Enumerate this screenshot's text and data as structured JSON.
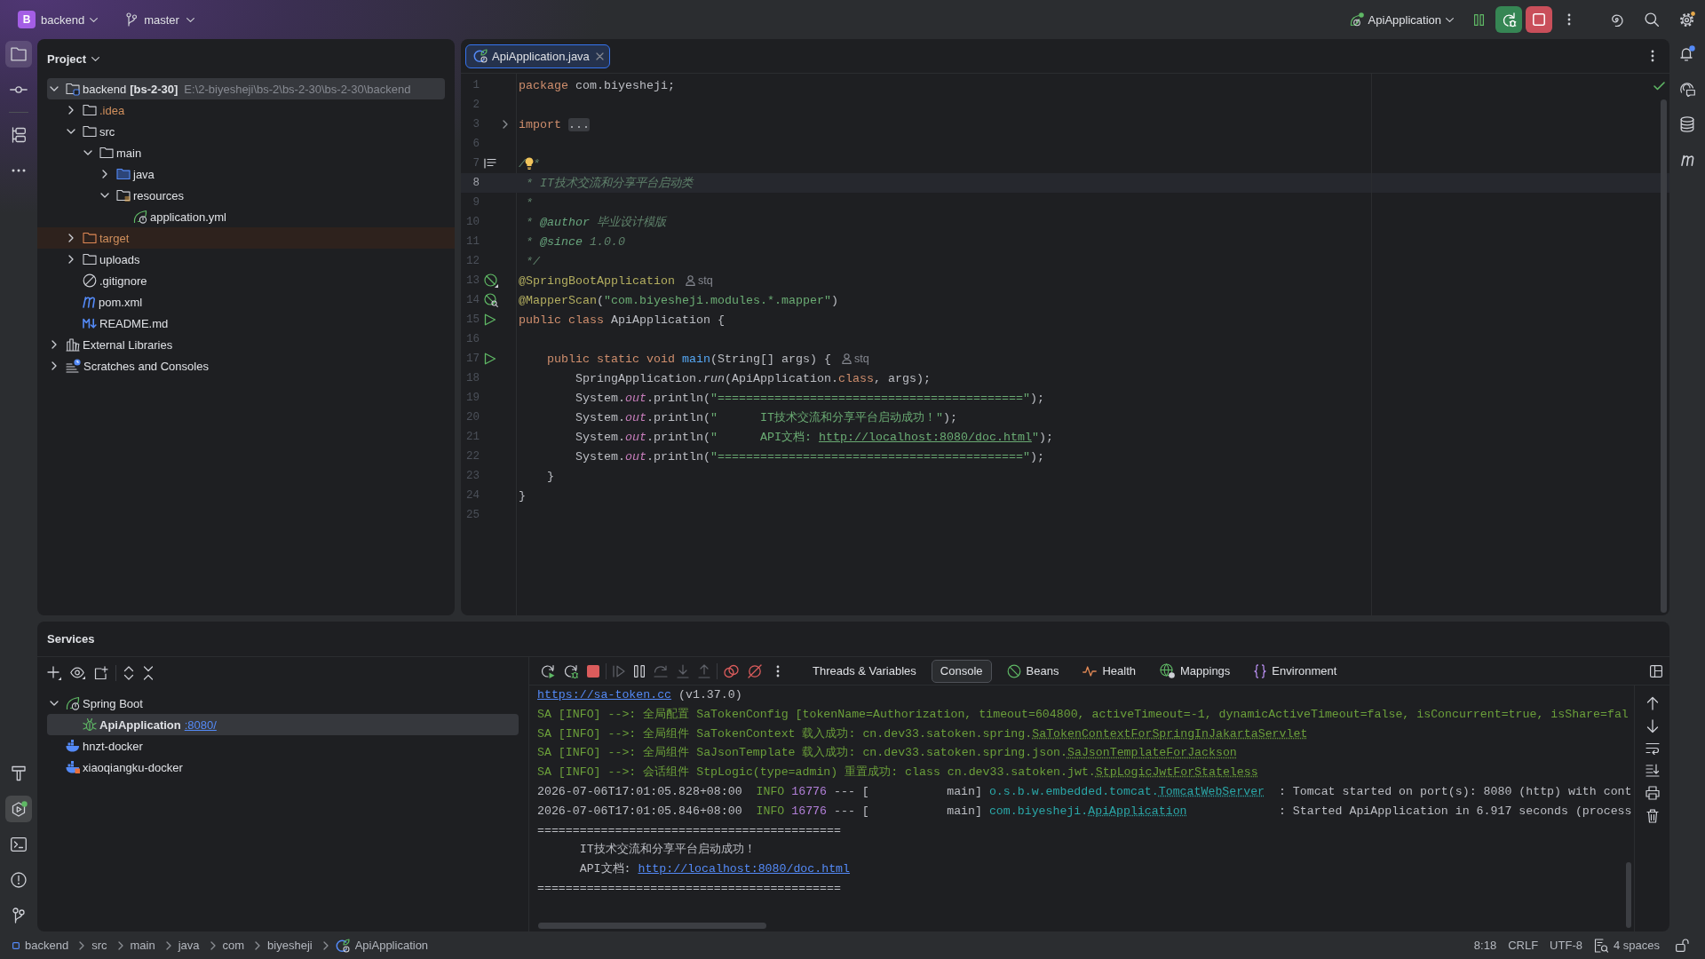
{
  "title_bar": {
    "project_badge": "B",
    "project": "backend",
    "branch": "master",
    "run_configuration": "ApiApplication"
  },
  "tool_strip_left": {
    "top": [
      {
        "selected": true
      },
      {
        "selected": false
      },
      {
        "selected": false
      },
      {
        "selected": false
      }
    ],
    "bottom": [
      {
        "selected": false
      },
      {
        "selected": true
      },
      {
        "selected": false
      },
      {
        "selected": false
      },
      {
        "selected": false
      }
    ]
  },
  "project_panel": {
    "title": "Project",
    "tree": [
      {
        "label": "backend",
        "module": "[bs-2-30]",
        "path": "E:\\2-biyesheji\\bs-2\\bs-2-30\\bs-2-30\\backend",
        "kind": "module",
        "expanded": true,
        "selected": true,
        "ignored": false,
        "excluded": false,
        "children": [
          {
            "label": ".idea",
            "kind": "folder",
            "expanded": false,
            "selected": false,
            "ignored": true,
            "excluded": false
          },
          {
            "label": "src",
            "kind": "folder",
            "expanded": true,
            "selected": false,
            "ignored": false,
            "excluded": false,
            "children": [
              {
                "label": "main",
                "kind": "folder",
                "expanded": true,
                "selected": false,
                "ignored": false,
                "excluded": false,
                "children": [
                  {
                    "label": "java",
                    "kind": "source-folder",
                    "expanded": false,
                    "selected": false,
                    "ignored": false,
                    "excluded": false
                  },
                  {
                    "label": "resources",
                    "kind": "resource-folder",
                    "expanded": true,
                    "selected": false,
                    "ignored": false,
                    "excluded": false,
                    "children": [
                      {
                        "label": "application.yml",
                        "kind": "spring-config",
                        "selected": false,
                        "ignored": false,
                        "excluded": false
                      }
                    ]
                  }
                ]
              }
            ]
          },
          {
            "label": "target",
            "kind": "folder",
            "expanded": false,
            "selected": false,
            "ignored": true,
            "excluded": true
          },
          {
            "label": "uploads",
            "kind": "folder",
            "expanded": false,
            "selected": false,
            "ignored": false,
            "excluded": false
          },
          {
            "label": ".gitignore",
            "kind": "ignore-file",
            "selected": false,
            "ignored": false,
            "excluded": false
          },
          {
            "label": "pom.xml",
            "kind": "maven",
            "selected": false,
            "ignored": false,
            "excluded": false
          },
          {
            "label": "README.md",
            "kind": "markdown",
            "selected": false,
            "ignored": false,
            "excluded": false
          }
        ]
      },
      {
        "label": "External Libraries",
        "kind": "libraries",
        "expanded": false,
        "selected": false,
        "ignored": false,
        "excluded": false
      },
      {
        "label": "Scratches and Consoles",
        "kind": "scratches",
        "expanded": false,
        "selected": false,
        "ignored": false,
        "excluded": false
      }
    ]
  },
  "editor": {
    "tabs": [
      {
        "label": "ApiApplication.java",
        "selected": true
      }
    ],
    "lines": [
      {
        "number": "1",
        "current": false,
        "tokens": [
          {
            "kind": "keyword",
            "text": "package"
          },
          {
            "kind": "plain",
            "text": " com.biyesheji;"
          }
        ]
      },
      {
        "number": "2",
        "current": false
      },
      {
        "number": "3",
        "current": false,
        "gutter": {
          "kind": "fold"
        },
        "tokens": [
          {
            "kind": "keyword",
            "text": "import "
          },
          {
            "kind": "folded",
            "text": "..."
          }
        ]
      },
      {
        "number": "6",
        "current": false
      },
      {
        "number": "7",
        "current": false,
        "gutter": {
          "kind": "doc"
        },
        "tokens": [
          {
            "kind": "doc",
            "text": "/"
          },
          {
            "kind": "bulb"
          },
          {
            "kind": "doc",
            "text": "*"
          }
        ]
      },
      {
        "number": "8",
        "current": true,
        "tokens": [
          {
            "kind": "doc",
            "text": " * IT技术交流和分享平台启动类"
          }
        ]
      },
      {
        "number": "9",
        "current": false,
        "tokens": [
          {
            "kind": "doc",
            "text": " *"
          }
        ]
      },
      {
        "number": "10",
        "current": false,
        "tokens": [
          {
            "kind": "doc",
            "text": " * "
          },
          {
            "kind": "doc-tag",
            "text": "@author"
          },
          {
            "kind": "doc",
            "text": " 毕业设计模版"
          }
        ]
      },
      {
        "number": "11",
        "current": false,
        "tokens": [
          {
            "kind": "doc",
            "text": " * "
          },
          {
            "kind": "doc-tag",
            "text": "@since"
          },
          {
            "kind": "doc",
            "text": " 1.0.0"
          }
        ]
      },
      {
        "number": "12",
        "current": false,
        "tokens": [
          {
            "kind": "doc",
            "text": " */"
          }
        ]
      },
      {
        "number": "13",
        "current": false,
        "gutter": {
          "kind": "bean"
        },
        "tokens": [
          {
            "kind": "annotation",
            "text": "@SpringBootApplication"
          },
          {
            "kind": "hint",
            "text": "stq"
          }
        ]
      },
      {
        "number": "14",
        "current": false,
        "gutter": {
          "kind": "mapper"
        },
        "tokens": [
          {
            "kind": "annotation",
            "text": "@MapperScan"
          },
          {
            "kind": "plain",
            "text": "("
          },
          {
            "kind": "string",
            "text": "\"com.biyesheji.modules.*.mapper\""
          },
          {
            "kind": "plain",
            "text": ")"
          }
        ]
      },
      {
        "number": "15",
        "current": false,
        "gutter": {
          "kind": "run"
        },
        "tokens": [
          {
            "kind": "keyword",
            "text": "public class"
          },
          {
            "kind": "plain",
            "text": " ApiApplication {"
          }
        ]
      },
      {
        "number": "16",
        "current": false
      },
      {
        "number": "17",
        "current": false,
        "gutter": {
          "kind": "run"
        },
        "tokens": [
          {
            "kind": "keyword",
            "text": "    public static void "
          },
          {
            "kind": "method",
            "text": "main"
          },
          {
            "kind": "plain",
            "text": "(String[] args) {"
          },
          {
            "kind": "hint",
            "text": "stq"
          }
        ]
      },
      {
        "number": "18",
        "current": false,
        "tokens": [
          {
            "kind": "plain",
            "text": "        SpringApplication."
          },
          {
            "kind": "static-call",
            "text": "run"
          },
          {
            "kind": "plain",
            "text": "(ApiApplication."
          },
          {
            "kind": "keyword",
            "text": "class"
          },
          {
            "kind": "plain",
            "text": ", args);"
          }
        ]
      },
      {
        "number": "19",
        "current": false,
        "tokens": [
          {
            "kind": "plain",
            "text": "        System."
          },
          {
            "kind": "static-field",
            "text": "out"
          },
          {
            "kind": "plain",
            "text": ".println("
          },
          {
            "kind": "string",
            "text": "\"===========================================\""
          },
          {
            "kind": "plain",
            "text": ");"
          }
        ]
      },
      {
        "number": "20",
        "current": false,
        "tokens": [
          {
            "kind": "plain",
            "text": "        System."
          },
          {
            "kind": "static-field",
            "text": "out"
          },
          {
            "kind": "plain",
            "text": ".println("
          },
          {
            "kind": "string",
            "text": "\"      IT技术交流和分享平台启动成功！\""
          },
          {
            "kind": "plain",
            "text": ");"
          }
        ]
      },
      {
        "number": "21",
        "current": false,
        "tokens": [
          {
            "kind": "plain",
            "text": "        System."
          },
          {
            "kind": "static-field",
            "text": "out"
          },
          {
            "kind": "plain",
            "text": ".println("
          },
          {
            "kind": "string",
            "text": "\"      API文档: "
          },
          {
            "kind": "string-link",
            "text": "http://localhost:8080/doc.html"
          },
          {
            "kind": "string",
            "text": "\""
          },
          {
            "kind": "plain",
            "text": ");"
          }
        ]
      },
      {
        "number": "22",
        "current": false,
        "tokens": [
          {
            "kind": "plain",
            "text": "        System."
          },
          {
            "kind": "static-field",
            "text": "out"
          },
          {
            "kind": "plain",
            "text": ".println("
          },
          {
            "kind": "string",
            "text": "\"===========================================\""
          },
          {
            "kind": "plain",
            "text": ");"
          }
        ]
      },
      {
        "number": "23",
        "current": false,
        "tokens": [
          {
            "kind": "plain",
            "text": "    }"
          }
        ]
      },
      {
        "number": "24",
        "current": false,
        "tokens": [
          {
            "kind": "plain",
            "text": "}"
          }
        ]
      },
      {
        "number": "25",
        "current": false
      }
    ]
  },
  "services_panel": {
    "title": "Services",
    "tree": [
      {
        "label": "Spring Boot",
        "kind": "spring-boot",
        "expanded": true,
        "selected": false,
        "children": [
          {
            "label": "ApiApplication",
            "link": ":8080/",
            "kind": "app",
            "selected": true
          }
        ]
      },
      {
        "label": "hnzt-docker",
        "kind": "docker",
        "selected": false
      },
      {
        "label": "xiaoqiangku-docker",
        "kind": "docker-flagged",
        "selected": false
      }
    ],
    "debug_toolbar": [
      {
        "disabled": false
      },
      {
        "disabled": false
      },
      {
        "disabled": false
      },
      {
        "disabled": true
      },
      {
        "disabled": false
      },
      {
        "disabled": true
      },
      {
        "disabled": true
      },
      {
        "disabled": true
      },
      {
        "disabled": false
      },
      {
        "disabled": false
      },
      {
        "disabled": false
      }
    ],
    "tabs": [
      {
        "label": "Threads & Variables",
        "kind": "plain",
        "selected": false
      },
      {
        "label": "Console",
        "kind": "plain",
        "selected": true
      },
      {
        "label": "Beans",
        "kind": "beans",
        "selected": false
      },
      {
        "label": "Health",
        "kind": "health",
        "selected": false
      },
      {
        "label": "Mappings",
        "kind": "mappings",
        "selected": false
      },
      {
        "label": "Environment",
        "kind": "environment",
        "selected": false
      }
    ],
    "console": {
      "lines": [
        {
          "tokens": [
            {
              "kind": "link",
              "text": "https://sa-token.cc"
            },
            {
              "kind": "plain",
              "text": " (v1.37.0)"
            }
          ]
        },
        {
          "tokens": [
            {
              "kind": "sa",
              "text": "SA [INFO] -->: 全局配置 SaTokenConfig [tokenName=Authorization, timeout=604800, activeTimeout=-1, dynamicActiveTimeout=false, isConcurrent=true, isShare=fal"
            }
          ]
        },
        {
          "tokens": [
            {
              "kind": "sa",
              "text": "SA [INFO] -->: 全局组件 SaTokenContext 载入成功: cn.dev33.satoken.spring."
            },
            {
              "kind": "sa-class",
              "text": "SaTokenContextForSpringInJakartaServlet"
            }
          ]
        },
        {
          "tokens": [
            {
              "kind": "sa",
              "text": "SA [INFO] -->: 全局组件 SaJsonTemplate 载入成功: cn.dev33.satoken.spring.json."
            },
            {
              "kind": "sa-class",
              "text": "SaJsonTemplateForJackson"
            }
          ]
        },
        {
          "tokens": [
            {
              "kind": "sa",
              "text": "SA [INFO] -->: 会话组件 StpLogic(type=admin) 重置成功: class cn.dev33.satoken.jwt."
            },
            {
              "kind": "sa-class",
              "text": "StpLogicJwtForStateless"
            }
          ]
        },
        {
          "tokens": [
            {
              "kind": "plain",
              "text": "2026-07-06T17:01:05.828+08:00"
            },
            {
              "kind": "level",
              "text": "  INFO"
            },
            {
              "kind": "pid",
              "text": " 16776"
            },
            {
              "kind": "plain",
              "text": " --- [           main] "
            },
            {
              "kind": "logger",
              "text": "o.s.b.w.embedded.tomcat."
            },
            {
              "kind": "logger-class",
              "text": "TomcatWebServer"
            },
            {
              "kind": "plain",
              "text": "  : Tomcat started on port(s): 8080 (http) with cont"
            }
          ]
        },
        {
          "tokens": [
            {
              "kind": "plain",
              "text": "2026-07-06T17:01:05.846+08:00"
            },
            {
              "kind": "level",
              "text": "  INFO"
            },
            {
              "kind": "pid",
              "text": " 16776"
            },
            {
              "kind": "plain",
              "text": " --- [           main] "
            },
            {
              "kind": "logger",
              "text": "com.biyesheji."
            },
            {
              "kind": "logger-class",
              "text": "ApiApplication"
            },
            {
              "kind": "plain",
              "text": "             : Started ApiApplication in 6.917 seconds (process"
            }
          ]
        },
        {
          "tokens": [
            {
              "kind": "plain",
              "text": "==========================================="
            }
          ]
        },
        {
          "tokens": [
            {
              "kind": "plain",
              "text": "      IT技术交流和分享平台启动成功！"
            }
          ]
        },
        {
          "tokens": [
            {
              "kind": "plain",
              "text": "      API文档: "
            },
            {
              "kind": "link",
              "text": "http://localhost:8080/doc.html"
            }
          ]
        },
        {
          "tokens": [
            {
              "kind": "plain",
              "text": "==========================================="
            }
          ]
        }
      ]
    }
  },
  "tool_strip_right": {
    "buttons": [
      {
        "selected": false
      },
      {
        "selected": false
      },
      {
        "selected": false
      },
      {
        "selected": false
      }
    ]
  },
  "status_bar": {
    "breadcrumbs": [
      {
        "label": "backend",
        "kind": "module"
      },
      {
        "label": "src",
        "kind": "plain"
      },
      {
        "label": "main",
        "kind": "plain"
      },
      {
        "label": "java",
        "kind": "plain"
      },
      {
        "label": "com",
        "kind": "plain"
      },
      {
        "label": "biyesheji",
        "kind": "plain"
      },
      {
        "label": "ApiApplication",
        "kind": "class"
      }
    ],
    "caret": "8:18",
    "line_separator": "CRLF",
    "encoding": "UTF-8",
    "indent": "4 spaces"
  }
}
